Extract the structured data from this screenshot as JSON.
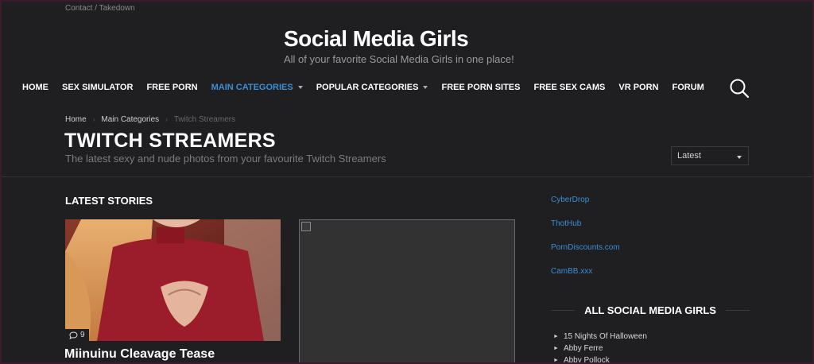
{
  "header": {
    "top_link": "Contact / Takedown",
    "logo": "Social Media Girls",
    "tagline": "All of your favorite Social Media Girls in one place!"
  },
  "nav": {
    "items": [
      {
        "label": "HOME"
      },
      {
        "label": "SEX SIMULATOR"
      },
      {
        "label": "FREE PORN"
      },
      {
        "label": "MAIN CATEGORIES"
      },
      {
        "label": "POPULAR CATEGORIES"
      },
      {
        "label": "FREE PORN SITES"
      },
      {
        "label": "FREE SEX CAMS"
      },
      {
        "label": "VR PORN"
      },
      {
        "label": "FORUM"
      }
    ],
    "search_icon": "search-icon"
  },
  "breadcrumb": [
    "Home",
    "Main Categories",
    "Twitch Streamers"
  ],
  "page": {
    "title": "TWITCH STREAMERS",
    "description": "The latest sexy and nude photos from your favourite Twitch Streamers",
    "sort_value": "Latest"
  },
  "content": {
    "section_title": "LATEST STORIES",
    "cards": [
      {
        "title": "Miinuinu Cleavage Tease",
        "comments": "9"
      }
    ]
  },
  "sidebar": {
    "links": [
      "CyberDrop",
      "ThotHub",
      "PornDiscounts.com",
      "CamBB.xxx"
    ],
    "heading": "ALL SOCIAL MEDIA GIRLS",
    "list": [
      "15 Nights Of Halloween",
      "Abby Ferre",
      "Abby Pollock"
    ]
  },
  "colors": {
    "background": "#1f1e20",
    "accent": "#3b8fd4",
    "text": "#ffffff"
  }
}
